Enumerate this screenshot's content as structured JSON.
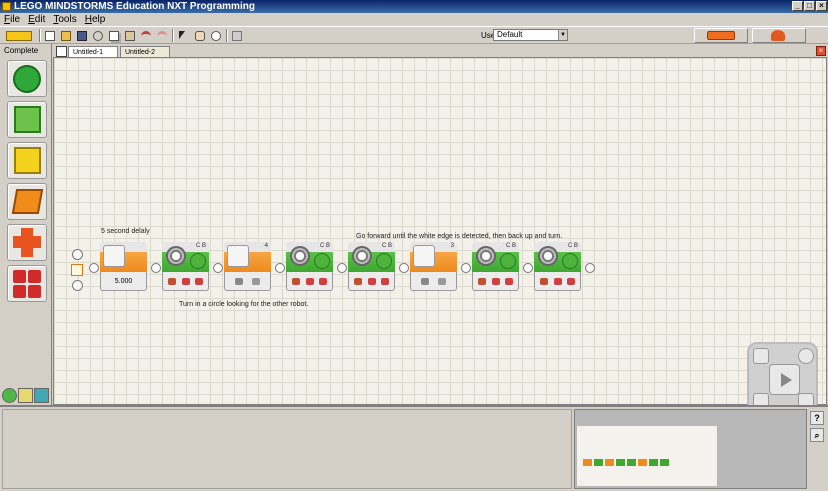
{
  "window": {
    "title": "LEGO MINDSTORMS Education NXT Programming"
  },
  "menu": [
    "File",
    "Edit",
    "Tools",
    "Help"
  ],
  "toolbar": {
    "profile_label": "User Profile:",
    "profile_value": "Default"
  },
  "palette": {
    "label": "Complete",
    "items": [
      {
        "name": "common-palette-move",
        "color": "#2fa83a"
      },
      {
        "name": "action-palette",
        "color": "#6cc24a"
      },
      {
        "name": "sensor-palette",
        "color": "#f2d21c"
      },
      {
        "name": "flow-palette",
        "color": "#f08c1a"
      },
      {
        "name": "data-palette",
        "color": "#e85420"
      },
      {
        "name": "advanced-palette",
        "color": "#d02a2a"
      }
    ]
  },
  "tabs": [
    {
      "label": "Untitled-1",
      "active": true
    },
    {
      "label": "Untitled-2",
      "active": false
    }
  ],
  "program": {
    "note_wait": "5 second delaly",
    "note_forward": "Go forward until the white edge is detected, then back up and turn.",
    "note_turn": "Turn in a circle looking for the other robot.",
    "blocks": [
      {
        "type": "wait-time",
        "kind": "orange",
        "port": "",
        "value": "5.000"
      },
      {
        "type": "move",
        "kind": "green",
        "port": "C B"
      },
      {
        "type": "wait-ultrasonic",
        "kind": "orange",
        "port": "4"
      },
      {
        "type": "move",
        "kind": "green",
        "port": "C B"
      },
      {
        "type": "move",
        "kind": "green",
        "port": "C B"
      },
      {
        "type": "wait-light",
        "kind": "orange",
        "port": "3"
      },
      {
        "type": "move",
        "kind": "green",
        "port": "C B"
      },
      {
        "type": "move",
        "kind": "green",
        "port": "C B"
      }
    ]
  },
  "colors": {
    "accent_green": "#3ea831",
    "accent_orange": "#ef8a20",
    "title_bar": "#0a246a"
  }
}
